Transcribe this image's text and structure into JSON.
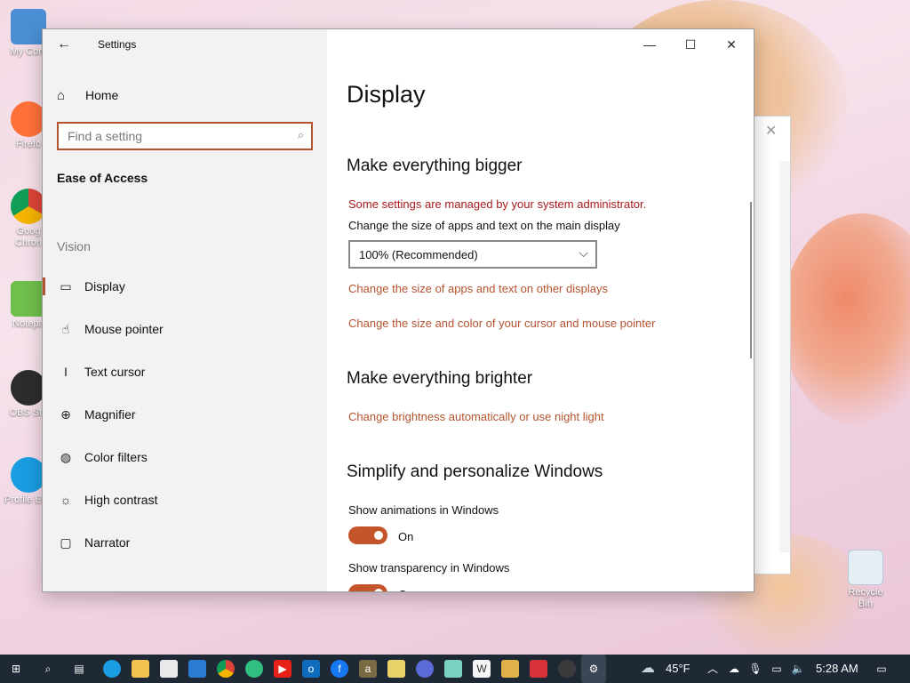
{
  "desktop": {
    "icons": [
      {
        "label": "My Com",
        "icon": "computer-icon",
        "color": "#4a8fd4"
      },
      {
        "label": "Firefo",
        "icon": "firefox-icon",
        "color": "#ff7139"
      },
      {
        "label": "Goog Chron",
        "icon": "chrome-icon",
        "color": "#4285f4"
      },
      {
        "label": "Notepa",
        "icon": "notepad-icon",
        "color": "#6fbf4c"
      },
      {
        "label": "OBS Stu",
        "icon": "obs-icon",
        "color": "#2c2c2c"
      },
      {
        "label": "Profile Edg",
        "icon": "edge-icon",
        "color": "#1b9de2"
      }
    ],
    "recycle_bin": {
      "label": "Recycle Bin",
      "icon": "recycle-bin-icon"
    }
  },
  "window": {
    "title": "Settings",
    "back_glyph": "←",
    "minimize_glyph": "—",
    "maximize_glyph": "☐",
    "close_glyph": "✕"
  },
  "sidebar": {
    "home_label": "Home",
    "search_placeholder": "Find a setting",
    "category_title": "Ease of Access",
    "group_label": "Vision",
    "items": [
      {
        "label": "Display",
        "icon": "display-icon",
        "glyph": "▭",
        "active": true
      },
      {
        "label": "Mouse pointer",
        "icon": "mouse-pointer-icon",
        "glyph": "☝",
        "active": false
      },
      {
        "label": "Text cursor",
        "icon": "text-cursor-icon",
        "glyph": "I",
        "active": false
      },
      {
        "label": "Magnifier",
        "icon": "magnifier-icon",
        "glyph": "⊕",
        "active": false
      },
      {
        "label": "Color filters",
        "icon": "color-filters-icon",
        "glyph": "◍",
        "active": false
      },
      {
        "label": "High contrast",
        "icon": "high-contrast-icon",
        "glyph": "☼",
        "active": false
      },
      {
        "label": "Narrator",
        "icon": "narrator-icon",
        "glyph": "▢",
        "active": false
      }
    ]
  },
  "main": {
    "page_title": "Display",
    "section_bigger": {
      "heading": "Make everything bigger",
      "admin_warning": "Some settings are managed by your system administrator.",
      "size_label": "Change the size of apps and text on the main display",
      "size_value": "100% (Recommended)",
      "link_other_displays": "Change the size of apps and text on other displays",
      "link_cursor": "Change the size and color of your cursor and mouse pointer"
    },
    "section_brighter": {
      "heading": "Make everything brighter",
      "link_brightness": "Change brightness automatically or use night light"
    },
    "section_simplify": {
      "heading": "Simplify and personalize Windows",
      "animations_label": "Show animations in Windows",
      "animations_state": "On",
      "transparency_label": "Show transparency in Windows",
      "transparency_state": "On"
    }
  },
  "taskbar": {
    "apps": [
      "start-icon",
      "search-icon",
      "task-view-icon",
      "edge-icon",
      "file-explorer-icon",
      "store-icon",
      "mail-icon",
      "chrome-icon",
      "edge-dev-icon",
      "youtube-icon",
      "outlook-icon",
      "facebook-icon",
      "amazon-icon",
      "calendar-app-icon",
      "video-icon",
      "notepad-icon",
      "word-icon",
      "package-icon",
      "app-red-icon",
      "obs-icon",
      "settings-icon"
    ],
    "weather": "45°F",
    "time": "5:28 AM"
  }
}
